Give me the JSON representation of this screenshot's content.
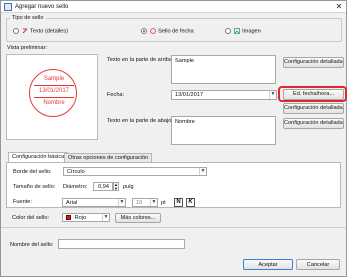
{
  "window": {
    "title": "Agregar nuevo sello",
    "close_glyph": "✕"
  },
  "stamp_type": {
    "legend": "Tipo de sello",
    "options": [
      {
        "label": "Texto (detalles)",
        "selected": false
      },
      {
        "label": "Sello de fecha",
        "selected": true
      },
      {
        "label": "Imagen",
        "selected": false
      }
    ]
  },
  "preview": {
    "label": "Vista preliminar:",
    "top": "Sample",
    "date": "13/01/2017",
    "bottom": "Nombre",
    "color": "#e13a3a"
  },
  "top_text": {
    "label": "Texto en la parte de arriba:",
    "value": "Sample",
    "button": "Configuración detallada..."
  },
  "date": {
    "label": "Fecha:",
    "value": "13/01/2017",
    "edit_button": "Ed. fecha/hora...",
    "detail_button": "Configuración detallada..."
  },
  "bottom_text": {
    "label": "Texto en la parte de abajo:",
    "value": "Nombre",
    "button": "Configuración detallada..."
  },
  "tabs": [
    {
      "label": "Configuración básica",
      "active": true
    },
    {
      "label": "Otras opciones de configuración",
      "active": false
    }
  ],
  "basic": {
    "border_label": "Borde del sello:",
    "border_value": "Círculo",
    "size_label": "Tamaño de sello:",
    "diameter_label": "Diámetro:",
    "diameter_value": "0,94",
    "unit": "pulg",
    "font_label": "Fuente:",
    "font_value": "Arial",
    "font_size_value": "10",
    "font_size_unit": "pt",
    "bold": "N",
    "italic": "K",
    "color_label": "Color del sello:",
    "color_value": "Rojo",
    "color_hex": "#e01919",
    "more_colors": "Más colores..."
  },
  "name": {
    "label": "Nombre del sello:",
    "value": ""
  },
  "footer": {
    "accept": "Aceptar",
    "cancel": "Cancelar"
  },
  "accent_highlight": "#e0262f"
}
